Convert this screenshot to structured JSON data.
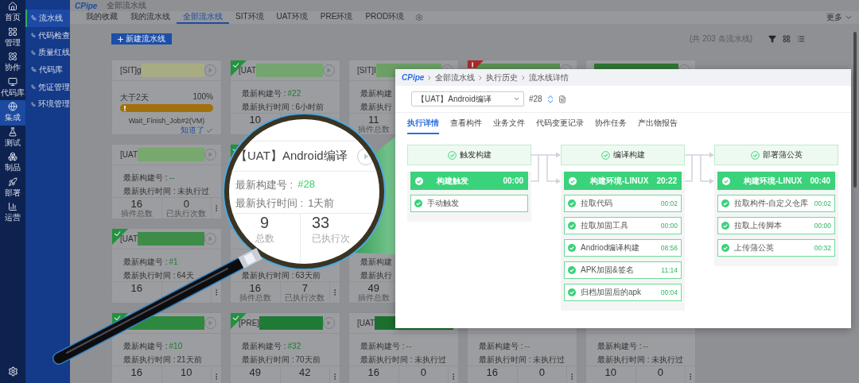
{
  "rail": {
    "items": [
      {
        "label": "首页",
        "selected": false
      },
      {
        "label": "管理",
        "selected": false
      },
      {
        "label": "协作",
        "selected": false
      },
      {
        "label": "代码库",
        "selected": false
      },
      {
        "label": "集成",
        "selected": true
      },
      {
        "label": "测试",
        "selected": false
      },
      {
        "label": "制品",
        "selected": false
      },
      {
        "label": "部署",
        "selected": false
      },
      {
        "label": "运营",
        "selected": false
      }
    ]
  },
  "subnav": {
    "items": [
      {
        "label": "流水线",
        "selected": true
      },
      {
        "label": "代码检查",
        "selected": false
      },
      {
        "label": "质量红线",
        "selected": false
      },
      {
        "label": "代码库",
        "selected": false
      },
      {
        "label": "凭证管理",
        "selected": false
      },
      {
        "label": "环境管理",
        "selected": false
      }
    ]
  },
  "breadcrumb": {
    "logo": "CPipe",
    "items": [
      "全部流水线"
    ]
  },
  "tabs": [
    {
      "label": "我的收藏",
      "selected": false
    },
    {
      "label": "我的流水线",
      "selected": false
    },
    {
      "label": "全部流水线",
      "selected": true
    },
    {
      "label": "SIT环境",
      "selected": false
    },
    {
      "label": "UAT环境",
      "selected": false
    },
    {
      "label": "PRE环境",
      "selected": false
    },
    {
      "label": "PROD环境",
      "selected": false
    }
  ],
  "more": "更多",
  "new_button": "新建流水线",
  "count": "(共 203 条流水线)",
  "card_rows": [
    [
      {
        "title": "[SIT]g",
        "color": "#a9ab83",
        "run_button": true,
        "progress": {
          "label": "大于2天",
          "reading": "100%",
          "level": 1,
          "job": "Wait_Finish_Job#2(VM)",
          "action": "知道了"
        }
      },
      {
        "succeeded": true,
        "title": "[UAT",
        "color": "#74a56f",
        "run_button": true,
        "build_label": "最新构建号 :",
        "build": "#22",
        "time_label": "最新执行时间 :",
        "time": "6小时前",
        "plugins": "10"
      },
      {
        "title": "[SIT]I",
        "color": "#6c9f66",
        "run_button": true,
        "build_label": "最新构建",
        "time_label": "最新执行",
        "plugins": "11",
        "plugins_label": "插件总数"
      },
      {
        "failed": true,
        "color": "#5b8f55",
        "run_button": true
      },
      {
        "color": "#2f7534",
        "run_button": true
      }
    ],
    [
      {
        "title": "[UAT",
        "color": "#77a86e",
        "run_button": true,
        "build_label": "最新构建号 :",
        "build": "--",
        "time_label": "最新执行时间 :",
        "time": "未执行过",
        "plugins": "16",
        "plugins_label": "插件总数",
        "runs": "0",
        "runs_label": "已执行次数",
        "menu": true
      },
      {
        "succeeded": true
      }
    ],
    [
      {
        "succeeded": true,
        "title": "[UAT",
        "color": "#3f8c48",
        "run_button": true,
        "build_label": "最新构建号 :",
        "build": "#1",
        "time_label": "最新执行时间 :",
        "time": "64天",
        "plugins": "16",
        "menu": true
      },
      {
        "time_label": "最新执行时间 :",
        "time": "63天前",
        "plugins": "16",
        "plugins_label": "插件总数",
        "runs": "7",
        "runs_label": "已执行次数",
        "menu": true
      },
      {
        "build_label": "最新构建",
        "time_label": "最新执行",
        "plugins": "49",
        "plugins_label": "插件总数"
      }
    ],
    [
      {
        "succeeded": true,
        "color": "#2f8840",
        "run_button": true,
        "build_label": "最新构建号 :",
        "build": "#10",
        "time_label": "最新执行时间 :",
        "time": "21天前",
        "plugins": "16",
        "runs": "10",
        "menu": true
      },
      {
        "succeeded": true,
        "title": "[PRE]",
        "color": "#1f7a35",
        "run_button": true,
        "build_label": "最新构建号 :",
        "build": "#32",
        "time_label": "最新执行时间 :",
        "time": "70天前",
        "plugins": "49",
        "runs": "42",
        "menu": true
      },
      {
        "title": "[UAT",
        "color": "#1c6f2f",
        "build_label": "最新构建号 :",
        "build": "--",
        "time_label": "最新执行时间 :",
        "time": "未执行过",
        "plugins": "16",
        "runs": "0",
        "menu": true
      },
      {
        "build_label": "最新构建号 :",
        "build": "--",
        "time_label": "最新执行时间 :",
        "time": "未执行过",
        "plugins": "16",
        "runs": "0",
        "menu": true
      },
      {
        "build_label": "最新构建号 :",
        "build": "--",
        "time_label": "最新执行时间 :",
        "time": "未执行过",
        "plugins": "10",
        "runs": "0",
        "menu": true
      }
    ]
  ],
  "magnifier": {
    "title": "【UAT】Android编译",
    "build_label": "最新构建号 :",
    "build": "#28",
    "time_label": "最新执行时间 :",
    "time": "1天前",
    "plugins": "9",
    "plugins_label": "总数",
    "runs": "33",
    "runs_label": "已执行次"
  },
  "detail": {
    "breadcrumb": {
      "logo": "CPipe",
      "items": [
        "全部流水线",
        "执行历史",
        "流水线详情"
      ]
    },
    "pipeline": "【UAT】Android编译",
    "build": "#28",
    "tabs": [
      {
        "label": "执行详情",
        "selected": true
      },
      {
        "label": "查看构件",
        "selected": false
      },
      {
        "label": "业务文件",
        "selected": false
      },
      {
        "label": "代码变更记录",
        "selected": false
      },
      {
        "label": "协作任务",
        "selected": false
      },
      {
        "label": "产出物报告",
        "selected": false
      }
    ],
    "stages": [
      {
        "name": "触发构建",
        "job": {
          "name": "构建触发",
          "time": "00:00"
        },
        "steps": [
          {
            "name": "手动触发"
          }
        ]
      },
      {
        "name": "编译构建",
        "job": {
          "name": "构建环境-LINUX",
          "time": "20:22"
        },
        "steps": [
          {
            "name": "拉取代码",
            "time": "00:02"
          },
          {
            "name": "拉取加固工具",
            "time": "00:00"
          },
          {
            "name": "Andriod编译构建",
            "time": "08:56"
          },
          {
            "name": "APK加固&签名",
            "time": "11:14"
          },
          {
            "name": "归档加固后的apk",
            "time": "00:04"
          }
        ]
      },
      {
        "name": "部署蒲公英",
        "job": {
          "name": "构建环境-LINUX",
          "time": "00:40"
        },
        "steps": [
          {
            "name": "拉取构件-自定义仓库",
            "time": "00:02"
          },
          {
            "name": "拉取上传脚本",
            "time": "00:00"
          },
          {
            "name": "上传蒲公英",
            "time": "00:32"
          }
        ]
      }
    ]
  }
}
